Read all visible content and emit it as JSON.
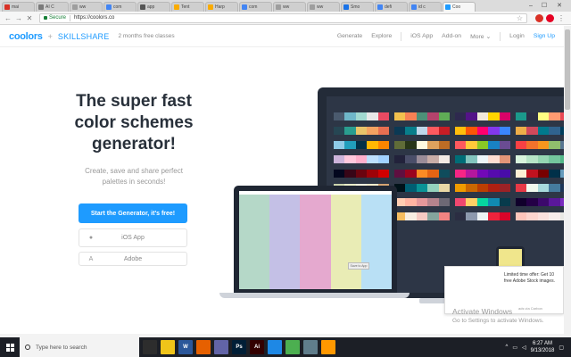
{
  "browser": {
    "tabs": [
      {
        "label": "mai",
        "color": "#d93025"
      },
      {
        "label": "AI C",
        "color": "#7a7a7a"
      },
      {
        "label": "ww",
        "color": "#9e9e9e"
      },
      {
        "label": "com",
        "color": "#4285f4"
      },
      {
        "label": "app",
        "color": "#555555"
      },
      {
        "label": "Tent",
        "color": "#f9ab00"
      },
      {
        "label": "Harp",
        "color": "#f9ab00"
      },
      {
        "label": "com",
        "color": "#4285f4"
      },
      {
        "label": "ww",
        "color": "#9e9e9e"
      },
      {
        "label": "ww",
        "color": "#9e9e9e"
      },
      {
        "label": "Smo",
        "color": "#1a73e8"
      },
      {
        "label": "defi",
        "color": "#4285f4"
      },
      {
        "label": "id c",
        "color": "#4285f4"
      },
      {
        "label": "Coo",
        "color": "#1e9bff",
        "active": true
      }
    ],
    "secure_label": "Secure",
    "url": "https://coolors.co"
  },
  "header": {
    "logo": "coolors",
    "plus": "+",
    "partner": "SKILLSHARE",
    "promo": "2 months free classes",
    "nav": [
      "Generate",
      "Explore",
      "iOS App",
      "Add-on",
      "More ⌄",
      "Login",
      "Sign Up"
    ]
  },
  "hero": {
    "title_lines": [
      "The super fast",
      "color schemes",
      "generator!"
    ],
    "subtitle_lines": [
      "Create, save and share perfect",
      "palettes in seconds!"
    ],
    "cta": "Start the Generator, it's free!",
    "ios": "iOS App",
    "adobe": "Adobe"
  },
  "illustration": {
    "laptop_colors": [
      "#b5d8c8",
      "#c4c0e6",
      "#e5a9cf",
      "#e9ecb5",
      "#b9e0f5"
    ],
    "monitor_palettes": [
      [
        "#4a5a6e",
        "#6fb7c9",
        "#a1d9d0",
        "#e8e8e8",
        "#e94a62"
      ],
      [
        "#f2c14e",
        "#f78154",
        "#4d9078",
        "#b4436c",
        "#5fad56"
      ],
      [
        "#2e294e",
        "#541388",
        "#f1e9da",
        "#ffd400",
        "#d90368"
      ],
      [
        "#1b998b",
        "#2d3047",
        "#fffd82",
        "#ff9b71",
        "#e84855"
      ],
      [
        "#264653",
        "#2a9d8f",
        "#e9c46a",
        "#f4a261",
        "#e76f51"
      ],
      [
        "#0b3954",
        "#087e8b",
        "#bfd7ea",
        "#ff5a5f",
        "#c81d25"
      ],
      [
        "#ffbe0b",
        "#fb5607",
        "#ff006e",
        "#8338ec",
        "#3a86ff"
      ],
      [
        "#edae49",
        "#d1495b",
        "#00798c",
        "#30638e",
        "#003d5b"
      ],
      [
        "#8ecae6",
        "#219ebc",
        "#023047",
        "#ffb703",
        "#fb8500"
      ],
      [
        "#606c38",
        "#283618",
        "#fefae0",
        "#dda15e",
        "#bc6c25"
      ],
      [
        "#ff595e",
        "#ffca3a",
        "#8ac926",
        "#1982c4",
        "#6a4c93"
      ],
      [
        "#f94144",
        "#f3722c",
        "#f8961e",
        "#90be6d",
        "#577590"
      ],
      [
        "#cdb4db",
        "#ffc8dd",
        "#ffafcc",
        "#bde0fe",
        "#a2d2ff"
      ],
      [
        "#22223b",
        "#4a4e69",
        "#9a8c98",
        "#c9ada7",
        "#f2e9e4"
      ],
      [
        "#006d77",
        "#83c5be",
        "#edf6f9",
        "#ffddd2",
        "#e29578"
      ],
      [
        "#d8f3dc",
        "#b7e4c7",
        "#95d5b2",
        "#74c69d",
        "#52b788"
      ],
      [
        "#03071e",
        "#370617",
        "#6a040f",
        "#9d0208",
        "#d00000"
      ],
      [
        "#5f0f40",
        "#9a031e",
        "#fb8b24",
        "#e36414",
        "#0f4c5c"
      ],
      [
        "#f72585",
        "#b5179e",
        "#7209b7",
        "#560bad",
        "#480ca8"
      ],
      [
        "#fdf0d5",
        "#c1121f",
        "#780000",
        "#003049",
        "#669bbc"
      ],
      [
        "#ccd5ae",
        "#e9edc9",
        "#fefae0",
        "#faedcd",
        "#d4a373"
      ],
      [
        "#001219",
        "#005f73",
        "#0a9396",
        "#94d2bd",
        "#e9d8a6"
      ],
      [
        "#ee9b00",
        "#ca6702",
        "#bb3e03",
        "#ae2012",
        "#9b2226"
      ],
      [
        "#e63946",
        "#f1faee",
        "#a8dadc",
        "#457b9d",
        "#1d3557"
      ],
      [
        "#333333",
        "#5e5e5e",
        "#8f8f8f",
        "#c1c1c1",
        "#eeeeee"
      ],
      [
        "#ffcdb2",
        "#ffb4a2",
        "#e5989b",
        "#b5838d",
        "#6d6875"
      ],
      [
        "#ef476f",
        "#ffd166",
        "#06d6a0",
        "#118ab2",
        "#073b4c"
      ],
      [
        "#10002b",
        "#240046",
        "#3c096c",
        "#5a189a",
        "#7b2cbf"
      ],
      [
        "#caf0f8",
        "#ade8f4",
        "#90e0ef",
        "#48cae4",
        "#00b4d8"
      ],
      [
        "#f6bd60",
        "#f7ede2",
        "#f5cac3",
        "#84a59d",
        "#f28482"
      ],
      [
        "#2b2d42",
        "#8d99ae",
        "#edf2f4",
        "#ef233c",
        "#d90429"
      ],
      [
        "#fec5bb",
        "#fcd5ce",
        "#fae1dd",
        "#f8edeb",
        "#e8e8e4"
      ]
    ],
    "laptop_tag": "Save to App",
    "ad_text": "Limited time offer: Get 10 free Adobe Stock images.",
    "ad_by": "ads via Carbon"
  },
  "watermark": {
    "line1": "Activate Windows",
    "line2": "Go to Settings to activate Windows."
  },
  "taskbar": {
    "search_placeholder": "Type here to search",
    "apps": [
      {
        "label": "",
        "color": "#2d2d2d",
        "name": "task-view-icon"
      },
      {
        "label": "",
        "color": "#f0c419",
        "name": "file-explorer-icon"
      },
      {
        "label": "W",
        "color": "#2b579a",
        "name": "word-icon"
      },
      {
        "label": "",
        "color": "#e66000",
        "name": "firefox-icon"
      },
      {
        "label": "",
        "color": "#6264a7",
        "name": "app-icon"
      },
      {
        "label": "Ps",
        "color": "#001e36",
        "name": "photoshop-icon"
      },
      {
        "label": "Ai",
        "color": "#330000",
        "name": "illustrator-icon"
      },
      {
        "label": "",
        "color": "#1e88e5",
        "name": "app-icon-2"
      },
      {
        "label": "",
        "color": "#4caf50",
        "name": "chrome-icon"
      },
      {
        "label": "",
        "color": "#607d8b",
        "name": "app-icon-3"
      },
      {
        "label": "",
        "color": "#ff9800",
        "name": "app-icon-4"
      }
    ],
    "time": "6:27 AM",
    "date": "9/13/2018"
  }
}
